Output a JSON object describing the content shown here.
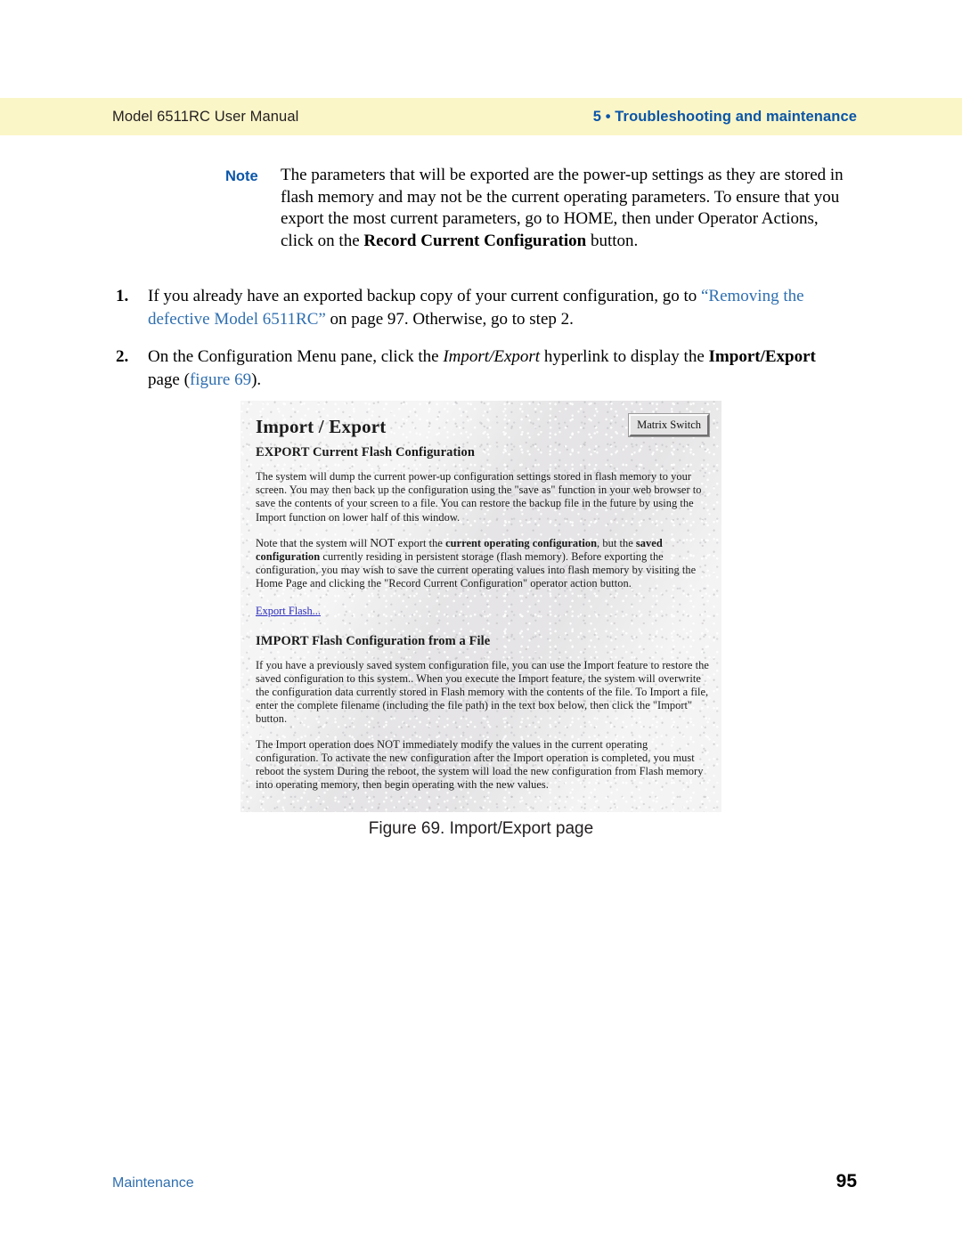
{
  "header": {
    "left_title": "Model 6511RC User Manual",
    "right_title": "5 • Troubleshooting and maintenance"
  },
  "note": {
    "label": "Note",
    "text_part1": "The parameters that will be exported are the power-up settings as they are stored in flash memory and may not be the current operating parameters. To ensure that you export the most current parameters, go to HOME, then under Operator Actions, click on the ",
    "bold_run": "Record Current Configuration",
    "text_part2": " button."
  },
  "steps": [
    {
      "number": "1.",
      "text_part1": "If you already have an exported backup copy of your current configuration, go to ",
      "link_text": "“Removing the defective Model 6511RC”",
      "text_part2": " on page 97. Otherwise, go to step 2."
    },
    {
      "number": "2.",
      "text_part1": "On the Configuration Menu pane, click the ",
      "italic_run": "Import/Export",
      "text_part2": " hyperlink to display the ",
      "bold_run": "Import/Export",
      "text_part3": " page (",
      "link_text": "figure 69",
      "text_part4": ")."
    }
  ],
  "screenshot": {
    "title": "Import / Export",
    "matrix_button": "Matrix Switch",
    "export_heading": "EXPORT Current Flash Configuration",
    "export_para1": "The system will dump the current power-up configuration settings stored in flash memory to your screen. You may then back up the configuration using the \"save as\" function in your web browser to save the contents of your screen to a file. You can restore the backup file in the future by using the Import function on lower half of this window.",
    "export_para2_a": "Note that the system will ",
    "export_para2_not": "NOT",
    "export_para2_b": " export the ",
    "export_para2_bold1": "current operating configuration",
    "export_para2_c": ", but the ",
    "export_para2_bold2": "saved configuration",
    "export_para2_d": " currently residing in persistent storage (flash memory). Before exporting the configuration, you may wish to save the current operating values into flash memory by visiting the Home Page and clicking the \"Record Current Configuration\" operator action button.",
    "export_link": "Export Flash...",
    "import_heading": "IMPORT Flash Configuration from a File",
    "import_para1": "If you have a previously saved system configuration file, you can use the Import feature to restore the saved configuration to this system.. When you execute the Import feature, the system will overwrite the configuration data currently stored in Flash memory with the contents of the file. To Import a file, enter the complete filename (including the file path) in the text box below, then click the \"Import\" button.",
    "import_para2": "The Import operation does NOT immediately modify the values in the current operating configuration. To activate the new configuration after the Import operation is completed, you must reboot the system During the reboot, the system will load the new configuration from Flash memory into operating memory, then begin operating with the new values."
  },
  "figure_caption": "Figure 69. Import/Export page",
  "footer": {
    "left_label": "Maintenance",
    "page_number": "95"
  },
  "colors": {
    "header_band": "#FBF6C8",
    "header_accent": "#0A55A8",
    "xref_blue": "#2F6FB0",
    "link_blue": "#2B2BBD",
    "screenshot_bg": "#E9E9E9"
  }
}
